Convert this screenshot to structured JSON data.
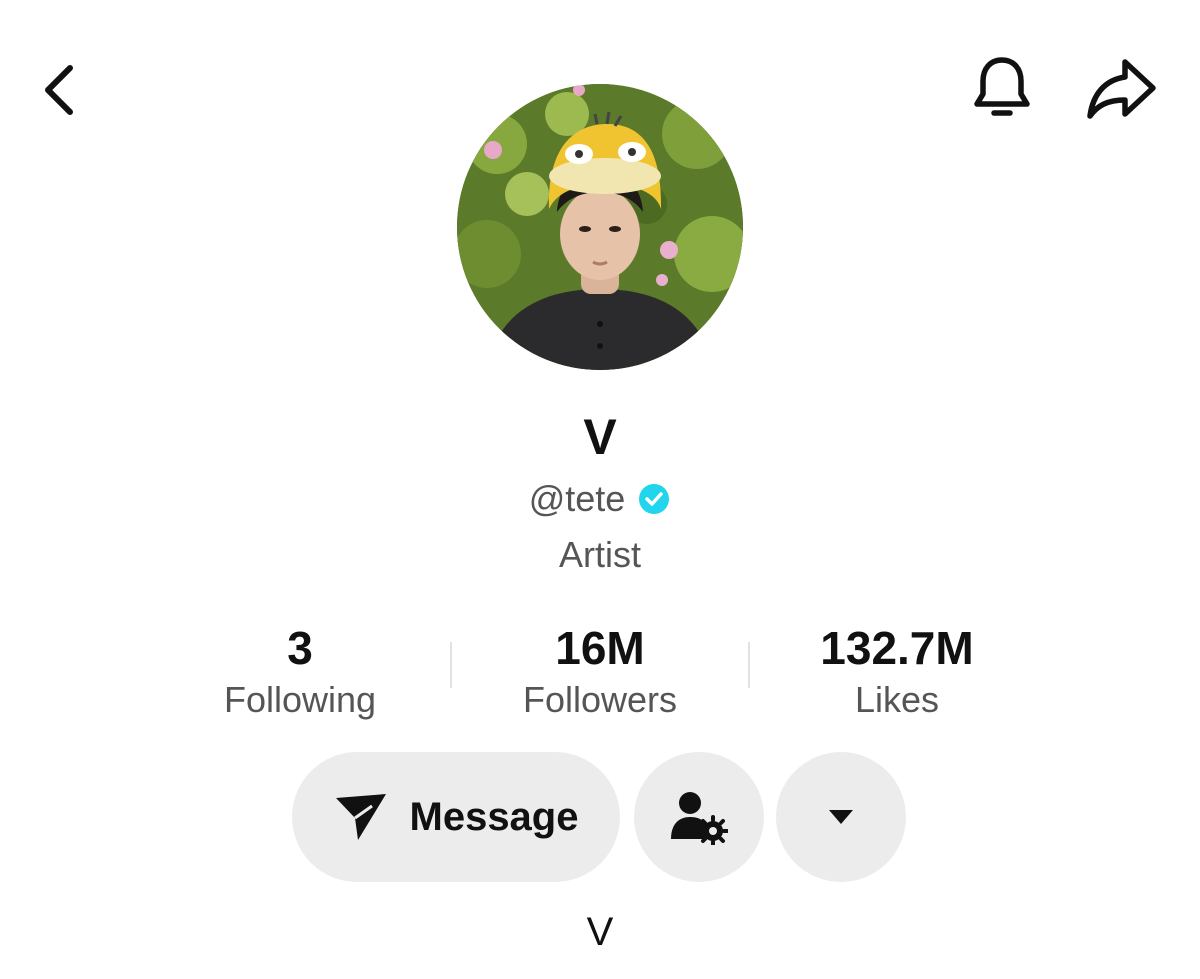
{
  "header": {
    "back_icon": "chevron-left-icon",
    "bell_icon": "bell-icon",
    "share_icon": "share-arrow-icon"
  },
  "profile": {
    "avatar": "profile-photo",
    "display_name": "V",
    "handle": "@tete",
    "verified_icon": "verified-badge-icon",
    "verified_color": "#20D5EC",
    "bio": "Artist"
  },
  "stats": [
    {
      "value": "3",
      "label": "Following"
    },
    {
      "value": "16M",
      "label": "Followers"
    },
    {
      "value": "132.7M",
      "label": "Likes"
    }
  ],
  "actions": {
    "message_label": "Message",
    "message_icon": "send-icon",
    "friends_icon": "user-settings-icon",
    "more_icon": "caret-down-icon"
  },
  "footer": {
    "text": "V"
  }
}
